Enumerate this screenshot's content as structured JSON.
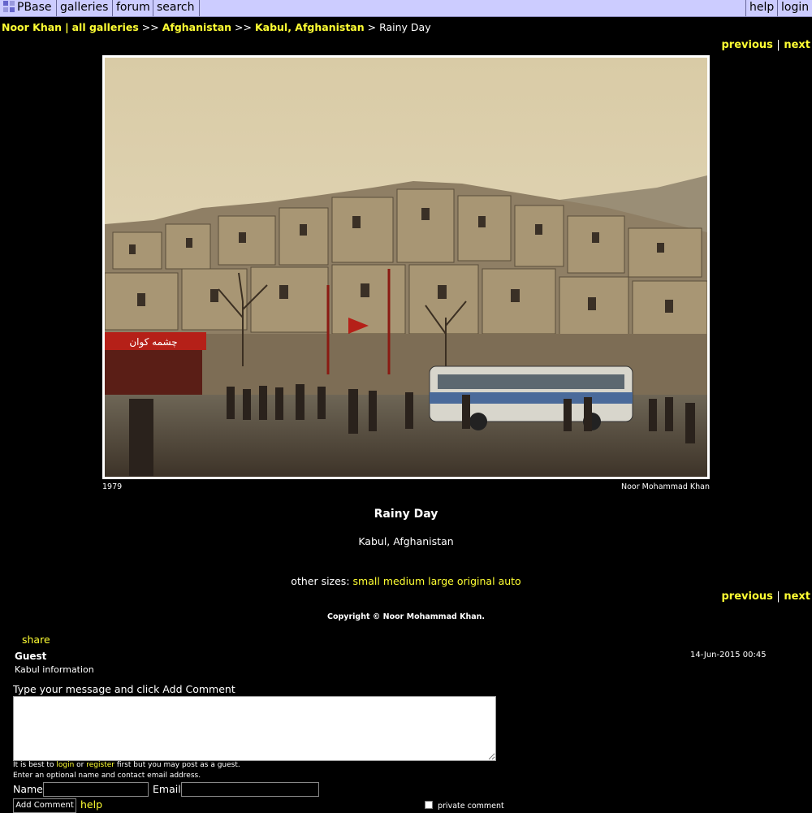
{
  "topbar": {
    "brand": "PBase",
    "galleries": "galleries",
    "forum": "forum",
    "search": "search",
    "help": "help",
    "login": "login"
  },
  "breadcrumb": {
    "owner": "Noor Khan",
    "all_galleries": "all galleries",
    "gallery": "Afghanistan",
    "subgallery": "Kabul, Afghanistan",
    "current": "Rainy Day",
    "sep_pipe": "|",
    "sep_arrow2": ">>",
    "sep_arrow": ">"
  },
  "nav": {
    "previous": "previous",
    "bar": "|",
    "next": "next"
  },
  "photo": {
    "caption_left": "1979",
    "caption_right": "Noor Mohammad Khan",
    "shop_sign": "چشمه کوان"
  },
  "image": {
    "title": "Rainy Day",
    "subtitle": "Kabul, Afghanistan"
  },
  "sizes": {
    "label": "other sizes:",
    "small": "small",
    "medium": "medium",
    "large": "large",
    "original": "original",
    "auto": "auto"
  },
  "copyright": "Copyright © Noor Mohammad Khan.",
  "share": "share",
  "comment": {
    "author": "Guest",
    "date": "14-Jun-2015 00:45",
    "body": "Kabul information"
  },
  "form": {
    "prompt": "Type your message and click Add Comment",
    "note_prefix": "It is best to",
    "login": "login",
    "or": "or",
    "register": "register",
    "note_suffix": "first but you may post as a guest.",
    "note2": "Enter an optional name and contact email address.",
    "name_label": "Name",
    "email_label": "Email",
    "add_button": "Add Comment",
    "help": "help",
    "private_label": "private comment"
  }
}
